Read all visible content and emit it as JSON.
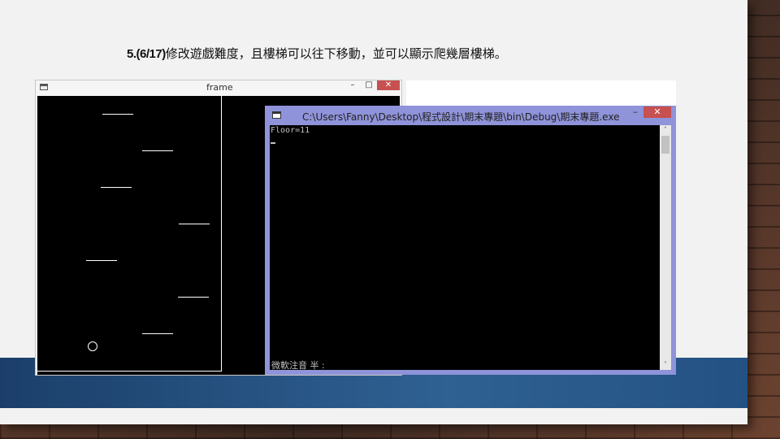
{
  "slide": {
    "title_number": "5.(6/17)",
    "title_text": "修改遊戲難度，且樓梯可以往下移動，並可以顯示爬幾層樓梯。"
  },
  "frame_window": {
    "title": "frame",
    "minimize_label": "–",
    "maximize_label": "□",
    "close_label": "✕"
  },
  "console_window": {
    "title": "C:\\Users\\Fanny\\Desktop\\程式設計\\期末專題\\bin\\Debug\\期末專題.exe",
    "output": "Floor=11",
    "ime_status": "微軟注音 半 :",
    "minimize_label": "–",
    "maximize_label": "□",
    "close_label": "✕",
    "scroll_up": "˄",
    "scroll_down": "˅"
  }
}
